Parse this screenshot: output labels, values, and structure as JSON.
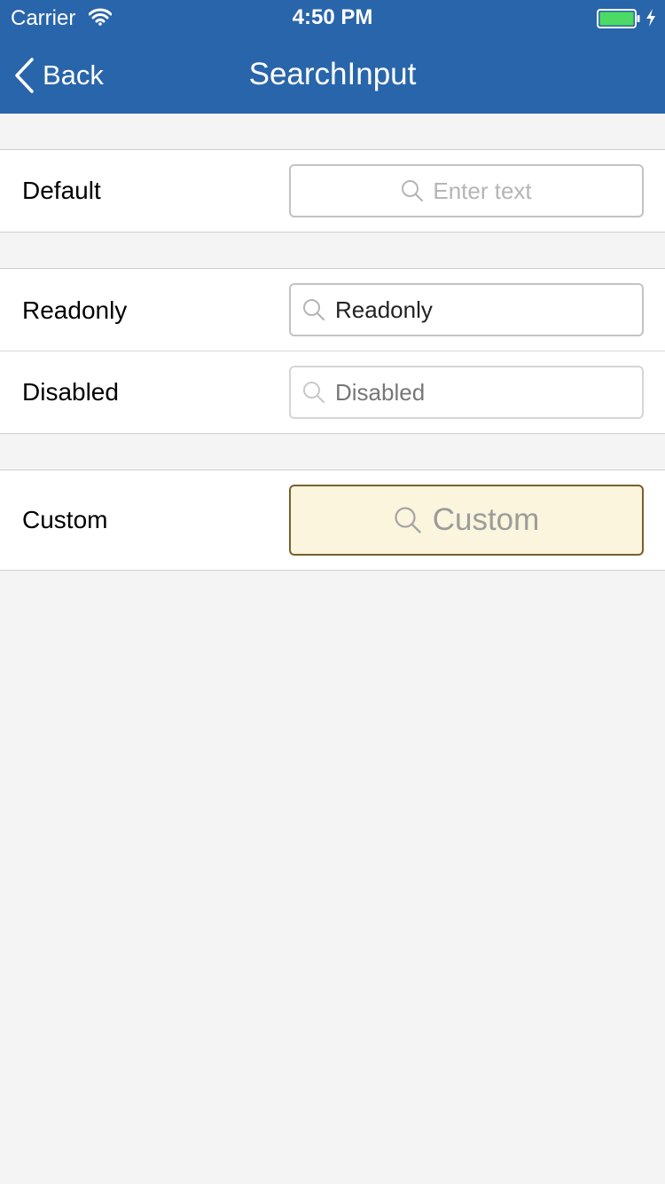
{
  "status_bar": {
    "carrier": "Carrier",
    "time": "4:50 PM",
    "battery_color": "#4cd964"
  },
  "nav": {
    "back_label": "Back",
    "title": "SearchInput"
  },
  "sections": {
    "default": {
      "label": "Default",
      "placeholder": "Enter text"
    },
    "readonly": {
      "label": "Readonly",
      "value": "Readonly"
    },
    "disabled": {
      "label": "Disabled",
      "value": "Disabled"
    },
    "custom": {
      "label": "Custom",
      "placeholder": "Custom"
    }
  },
  "colors": {
    "header_bg": "#2965aa",
    "page_bg": "#f4f4f4",
    "custom_bg": "#faf5dc",
    "custom_border": "#7a5f2d"
  },
  "icons": [
    "wifi-icon",
    "battery-icon",
    "charge-icon",
    "chevron-left-icon",
    "search-icon"
  ]
}
